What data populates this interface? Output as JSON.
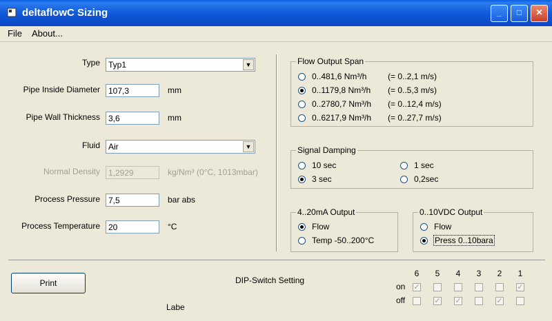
{
  "window": {
    "title": "deltaflowC Sizing",
    "controls": {
      "minimize": "_",
      "maximize": "□",
      "close": "✕"
    }
  },
  "menu": {
    "file": "File",
    "about": "About..."
  },
  "form": {
    "type": {
      "label": "Type",
      "value": "Typ1"
    },
    "pipe_diameter": {
      "label": "Pipe Inside Diameter",
      "value": "107,3",
      "unit": "mm"
    },
    "wall_thickness": {
      "label": "Pipe Wall Thickness",
      "value": "3,6",
      "unit": "mm"
    },
    "fluid": {
      "label": "Fluid",
      "value": "Air"
    },
    "normal_density": {
      "label": "Normal Density",
      "value": "1,2929",
      "unit": "kg/Nm³ (0°C, 1013mbar)"
    },
    "process_pressure": {
      "label": "Process Pressure",
      "value": "7,5",
      "unit": "bar abs"
    },
    "process_temperature": {
      "label": "Process Temperature",
      "value": "20",
      "unit": "°C"
    }
  },
  "flow_output_span": {
    "title": "Flow Output Span",
    "selected": 1,
    "options": [
      {
        "range": "0..481,6 Nm³/h",
        "velocity": "(= 0..2,1 m/s)"
      },
      {
        "range": "0..1179,8 Nm³/h",
        "velocity": "(= 0..5,3 m/s)"
      },
      {
        "range": "0..2780,7 Nm³/h",
        "velocity": "(= 0..12,4 m/s)"
      },
      {
        "range": "0..6217,9 Nm³/h",
        "velocity": "(= 0..27,7 m/s)"
      }
    ]
  },
  "signal_damping": {
    "title": "Signal Damping",
    "options": [
      "10 sec",
      "3 sec",
      "1 sec",
      "0,2sec"
    ],
    "selected": "3 sec"
  },
  "output_4_20": {
    "title": "4..20mA Output",
    "options": [
      "Flow",
      "Temp -50..200°C"
    ],
    "selected": "Flow"
  },
  "output_0_10": {
    "title": "0..10VDC Output",
    "options": [
      "Flow",
      "Press 0..10bara"
    ],
    "selected": "Press 0..10bara"
  },
  "footer": {
    "print_label": "Print",
    "dip_title": "DIP-Switch Setting",
    "label_text": "Labe",
    "on_label": "on",
    "off_label": "off",
    "switch_numbers": [
      "6",
      "5",
      "4",
      "3",
      "2",
      "1"
    ],
    "on_checked": [
      true,
      false,
      false,
      false,
      false,
      true
    ],
    "off_checked": [
      false,
      true,
      true,
      false,
      true,
      false
    ]
  }
}
